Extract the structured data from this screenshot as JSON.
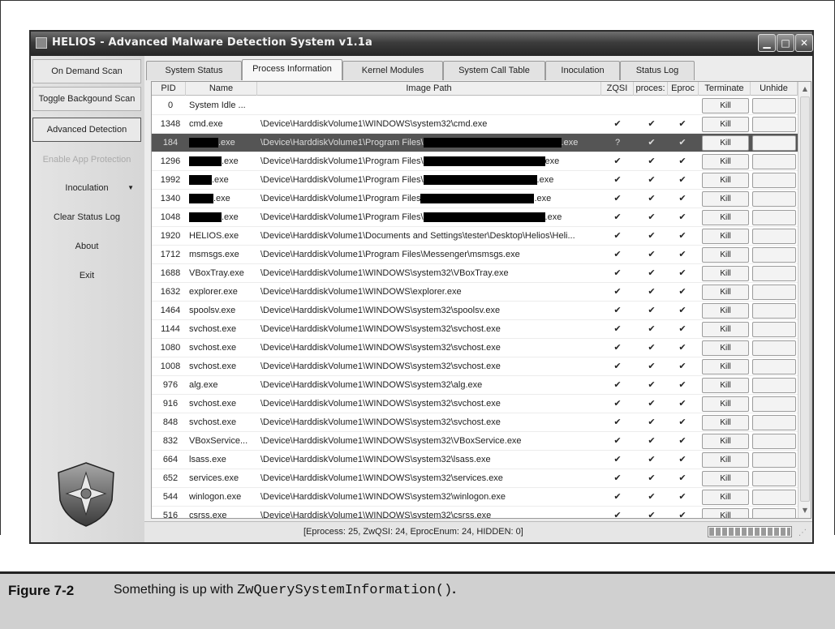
{
  "window": {
    "title": "HELIOS - Advanced Malware Detection System v1.1a"
  },
  "sidebar": {
    "items": [
      {
        "label": "On Demand Scan"
      },
      {
        "label": "Toggle Backgound Scan"
      },
      {
        "label": "Advanced Detection"
      },
      {
        "label": "Enable App Protection"
      },
      {
        "label": "Inoculation"
      },
      {
        "label": "Clear Status Log"
      },
      {
        "label": "About"
      },
      {
        "label": "Exit"
      }
    ]
  },
  "tabs": [
    {
      "label": "System Status"
    },
    {
      "label": "Process Information"
    },
    {
      "label": "Kernel Modules"
    },
    {
      "label": "System Call Table"
    },
    {
      "label": "Inoculation"
    },
    {
      "label": "Status Log"
    }
  ],
  "table": {
    "headers": [
      "PID",
      "Name",
      "Image Path",
      "ZQSI",
      "proces:",
      "Eproc",
      "Terminate",
      "Unhide"
    ],
    "kill_label": "Kill",
    "check": "✔",
    "unknown": "?",
    "rows": [
      {
        "pid": "0",
        "name": "System Idle ...",
        "path": "",
        "zq": "",
        "pr": "",
        "ep": ""
      },
      {
        "pid": "1348",
        "name": "cmd.exe",
        "path": "\\Device\\HarddiskVolume1\\WINDOWS\\system32\\cmd.exe",
        "zq": "✔",
        "pr": "✔",
        "ep": "✔"
      },
      {
        "pid": "184",
        "name_suffix": ".exe",
        "path_prefix": "\\Device\\HarddiskVolume1\\Program Files\\",
        "path_suffix": ".exe",
        "zq": "?",
        "pr": "✔",
        "ep": "✔"
      },
      {
        "pid": "1296",
        "name_suffix": ".exe",
        "path_prefix": "\\Device\\HarddiskVolume1\\Program Files\\",
        "path_suffix": "exe",
        "zq": "✔",
        "pr": "✔",
        "ep": "✔"
      },
      {
        "pid": "1992",
        "name_suffix": ".exe",
        "path_prefix": "\\Device\\HarddiskVolume1\\Program Files\\",
        "path_suffix": ".exe",
        "zq": "✔",
        "pr": "✔",
        "ep": "✔"
      },
      {
        "pid": "1340",
        "name_suffix": ".exe",
        "path_prefix": "\\Device\\HarddiskVolume1\\Program Files",
        "path_suffix": ".exe",
        "zq": "✔",
        "pr": "✔",
        "ep": "✔"
      },
      {
        "pid": "1048",
        "name_suffix": ".exe",
        "path_prefix": "\\Device\\HarddiskVolume1\\Program Files\\",
        "path_suffix": ".exe",
        "zq": "✔",
        "pr": "✔",
        "ep": "✔"
      },
      {
        "pid": "1920",
        "name": "HELIOS.exe",
        "path": "\\Device\\HarddiskVolume1\\Documents and Settings\\tester\\Desktop\\Helios\\Heli...",
        "zq": "✔",
        "pr": "✔",
        "ep": "✔"
      },
      {
        "pid": "1712",
        "name": "msmsgs.exe",
        "path": "\\Device\\HarddiskVolume1\\Program Files\\Messenger\\msmsgs.exe",
        "zq": "✔",
        "pr": "✔",
        "ep": "✔"
      },
      {
        "pid": "1688",
        "name": "VBoxTray.exe",
        "path": "\\Device\\HarddiskVolume1\\WINDOWS\\system32\\VBoxTray.exe",
        "zq": "✔",
        "pr": "✔",
        "ep": "✔"
      },
      {
        "pid": "1632",
        "name": "explorer.exe",
        "path": "\\Device\\HarddiskVolume1\\WINDOWS\\explorer.exe",
        "zq": "✔",
        "pr": "✔",
        "ep": "✔"
      },
      {
        "pid": "1464",
        "name": "spoolsv.exe",
        "path": "\\Device\\HarddiskVolume1\\WINDOWS\\system32\\spoolsv.exe",
        "zq": "✔",
        "pr": "✔",
        "ep": "✔"
      },
      {
        "pid": "1144",
        "name": "svchost.exe",
        "path": "\\Device\\HarddiskVolume1\\WINDOWS\\system32\\svchost.exe",
        "zq": "✔",
        "pr": "✔",
        "ep": "✔"
      },
      {
        "pid": "1080",
        "name": "svchost.exe",
        "path": "\\Device\\HarddiskVolume1\\WINDOWS\\system32\\svchost.exe",
        "zq": "✔",
        "pr": "✔",
        "ep": "✔"
      },
      {
        "pid": "1008",
        "name": "svchost.exe",
        "path": "\\Device\\HarddiskVolume1\\WINDOWS\\system32\\svchost.exe",
        "zq": "✔",
        "pr": "✔",
        "ep": "✔"
      },
      {
        "pid": "976",
        "name": "alg.exe",
        "path": "\\Device\\HarddiskVolume1\\WINDOWS\\system32\\alg.exe",
        "zq": "✔",
        "pr": "✔",
        "ep": "✔"
      },
      {
        "pid": "916",
        "name": "svchost.exe",
        "path": "\\Device\\HarddiskVolume1\\WINDOWS\\system32\\svchost.exe",
        "zq": "✔",
        "pr": "✔",
        "ep": "✔"
      },
      {
        "pid": "848",
        "name": "svchost.exe",
        "path": "\\Device\\HarddiskVolume1\\WINDOWS\\system32\\svchost.exe",
        "zq": "✔",
        "pr": "✔",
        "ep": "✔"
      },
      {
        "pid": "832",
        "name": "VBoxService...",
        "path": "\\Device\\HarddiskVolume1\\WINDOWS\\system32\\VBoxService.exe",
        "zq": "✔",
        "pr": "✔",
        "ep": "✔"
      },
      {
        "pid": "664",
        "name": "lsass.exe",
        "path": "\\Device\\HarddiskVolume1\\WINDOWS\\system32\\lsass.exe",
        "zq": "✔",
        "pr": "✔",
        "ep": "✔"
      },
      {
        "pid": "652",
        "name": "services.exe",
        "path": "\\Device\\HarddiskVolume1\\WINDOWS\\system32\\services.exe",
        "zq": "✔",
        "pr": "✔",
        "ep": "✔"
      },
      {
        "pid": "544",
        "name": "winlogon.exe",
        "path": "\\Device\\HarddiskVolume1\\WINDOWS\\system32\\winlogon.exe",
        "zq": "✔",
        "pr": "✔",
        "ep": "✔"
      },
      {
        "pid": "516",
        "name": "csrss.exe",
        "path": "\\Device\\HarddiskVolume1\\WINDOWS\\system32\\csrss.exe",
        "zq": "✔",
        "pr": "✔",
        "ep": "✔"
      }
    ]
  },
  "status": {
    "text": "[Eprocess: 25, ZwQSI: 24, EprocEnum: 24, HIDDEN: 0]",
    "progress_fraction": 1.0
  },
  "caption": {
    "label": "Figure 7-2",
    "text_prefix": "Something is up with ",
    "code": "ZwQuerySystemInformation()",
    "text_suffix": "."
  },
  "colors": {
    "titlebar": "#262626",
    "selected_row": "#555555",
    "caption_bg": "#d0d0d0"
  }
}
